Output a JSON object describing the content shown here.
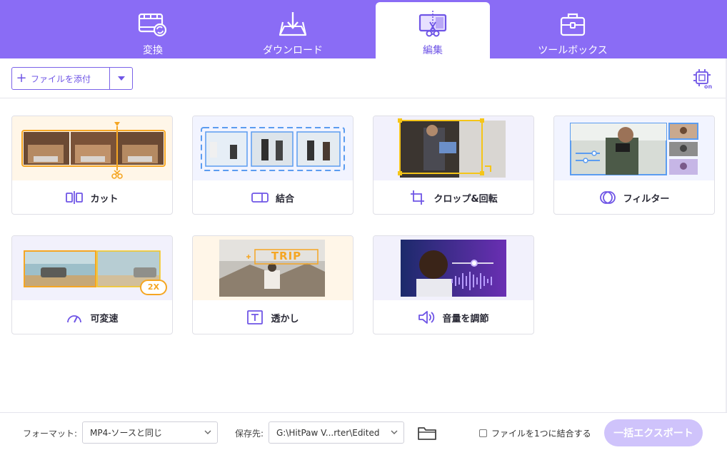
{
  "nav": {
    "tabs": [
      {
        "id": "convert",
        "label": "変換",
        "icon": "film-convert-icon"
      },
      {
        "id": "download",
        "label": "ダウンロード",
        "icon": "download-tray-icon"
      },
      {
        "id": "edit",
        "label": "編集",
        "icon": "edit-scissors-icon",
        "active": true
      },
      {
        "id": "toolbox",
        "label": "ツールボックス",
        "icon": "toolbox-icon"
      }
    ]
  },
  "toolbar": {
    "add_file_label": "ファイルを添付",
    "gpu_icon": "gpu-chip-on-icon"
  },
  "features": [
    {
      "id": "cut",
      "label": "カット",
      "icon": "cut-icon"
    },
    {
      "id": "merge",
      "label": "結合",
      "icon": "merge-icon"
    },
    {
      "id": "crop",
      "label": "クロップ&回転",
      "icon": "crop-icon"
    },
    {
      "id": "filter",
      "label": "フィルター",
      "icon": "filter-icon"
    },
    {
      "id": "speed",
      "label": "可変速",
      "icon": "speedometer-icon",
      "badge": "2X"
    },
    {
      "id": "watermark",
      "label": "透かし",
      "icon": "text-box-icon",
      "overlay_text": "TRIP"
    },
    {
      "id": "volume",
      "label": "音量を調節",
      "icon": "speaker-icon"
    }
  ],
  "footer": {
    "format_label": "フォーマット:",
    "format_value": "MP4-ソースと同じ",
    "save_label": "保存先:",
    "save_value": "G:\\HitPaw V...rter\\Edited",
    "merge_label": "ファイルを1つに結合する",
    "export_label": "一括エクスポート"
  },
  "colors": {
    "accent": "#8a6cf5",
    "accent_dark": "#6f55e6",
    "highlight": "#f5a623",
    "frame_blue": "#5b9cf0",
    "export_disabled": "#cfc3fb"
  }
}
